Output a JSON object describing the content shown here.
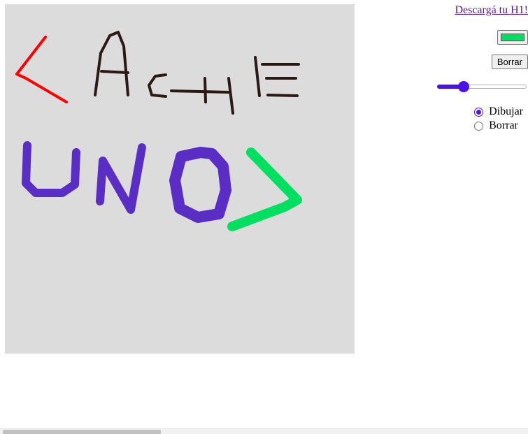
{
  "download": {
    "label": "Descargá tu H1!"
  },
  "color_picker": {
    "value": "#00e060"
  },
  "toolbar": {
    "clear_label": "Borrar"
  },
  "brush_size": {
    "level": 0.3
  },
  "mode": {
    "options": [
      {
        "label": "Dibujar",
        "checked": true
      },
      {
        "label": "Borrar",
        "checked": false
      }
    ]
  },
  "drawing_colors": {
    "red": "#ff0000",
    "dark": "#2b1a14",
    "purple": "#5a2ec4",
    "green": "#00e060",
    "canvas_bg": "#dcdcdc"
  }
}
